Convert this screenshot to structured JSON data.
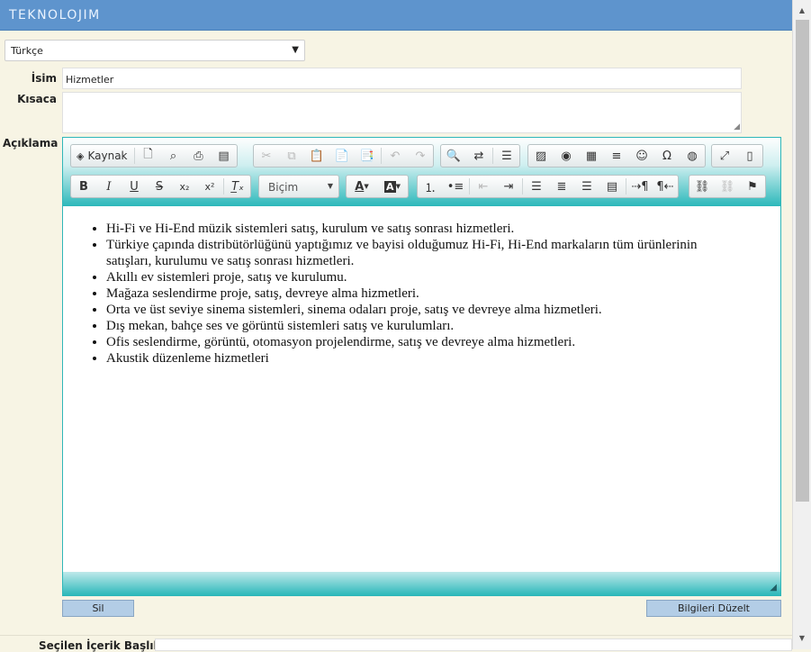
{
  "header": {
    "brand": "TEKNOLOJIM"
  },
  "language_select": {
    "value": "Türkçe"
  },
  "form": {
    "name_label": "İsim",
    "name_value": "Hizmetler",
    "short_label": "Kısaca",
    "short_value": "",
    "description_label": "Açıklama"
  },
  "toolbar": {
    "source_label": "Kaynak",
    "format_combo": "Biçim"
  },
  "content": {
    "items": [
      "Hi-Fi ve Hi-End müzik sistemleri satış, kurulum ve satış sonrası hizmetleri.",
      "Türkiye çapında distribütörlüğünü yaptığımız ve bayisi olduğumuz Hi-Fi, Hi-End markaların tüm ürünlerinin satışları, kurulumu ve satış sonrası hizmetleri.",
      "Akıllı ev sistemleri proje, satış ve kurulumu.",
      "Mağaza seslendirme proje, satış, devreye alma hizmetleri.",
      "Orta ve üst seviye sinema sistemleri, sinema odaları proje, satış ve devreye alma hizmetleri.",
      "Dış mekan, bahçe ses ve görüntü sistemleri satış ve kurulumları.",
      "Ofis seslendirme, görüntü, otomasyon projelendirme, satış ve devreye alma hizmetleri.",
      "Akustik düzenleme hizmetleri"
    ]
  },
  "buttons": {
    "delete": "Sil",
    "update": "Bilgileri Düzelt"
  },
  "next_section": {
    "label": "Seçilen İçerik Başlık"
  },
  "colors": {
    "header_bg": "#5e94cd",
    "page_bg": "#f7f4e4",
    "editor_accent": "#2cb8ba",
    "button_bg": "#b3cde6"
  }
}
